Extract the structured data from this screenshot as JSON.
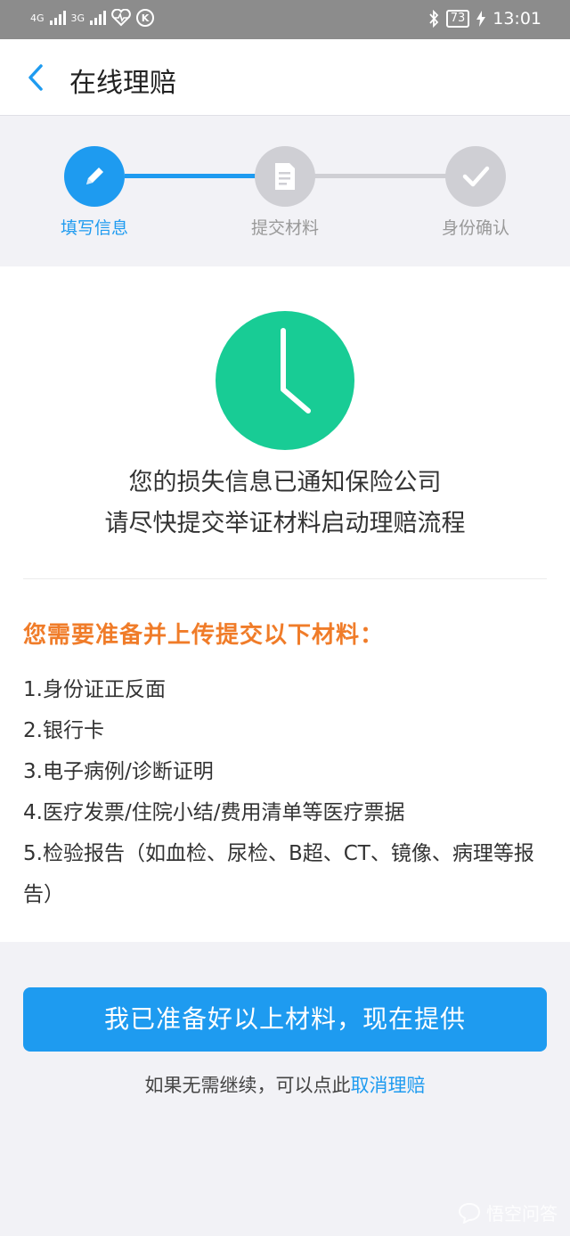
{
  "status_bar": {
    "network1": "4G",
    "network2": "3G",
    "k_badge": "K",
    "battery": "73",
    "time": "13:01"
  },
  "nav": {
    "title": "在线理赔"
  },
  "steps": [
    {
      "label": "填写信息",
      "state": "active"
    },
    {
      "label": "提交材料",
      "state": "inactive"
    },
    {
      "label": "身份确认",
      "state": "inactive"
    }
  ],
  "notice": {
    "line1": "您的损失信息已通知保险公司",
    "line2": "请尽快提交举证材料启动理赔流程"
  },
  "requirements": {
    "title": "您需要准备并上传提交以下材料：",
    "items": [
      "1.身份证正反面",
      "2.银行卡",
      "3.电子病例/诊断证明",
      "4.医疗发票/住院小结/费用清单等医疗票据",
      "5.检验报告（如血检、尿检、B超、CT、镜像、病理等报告）"
    ]
  },
  "primary_button": "我已准备好以上材料，现在提供",
  "cancel": {
    "prefix": "如果无需继续，可以点此",
    "link": "取消理赔"
  },
  "watermark": "悟空问答",
  "colors": {
    "accent": "#1e9bf0",
    "clock": "#18cc95",
    "highlight": "#f07c29",
    "inactive": "#cfcfd4"
  }
}
